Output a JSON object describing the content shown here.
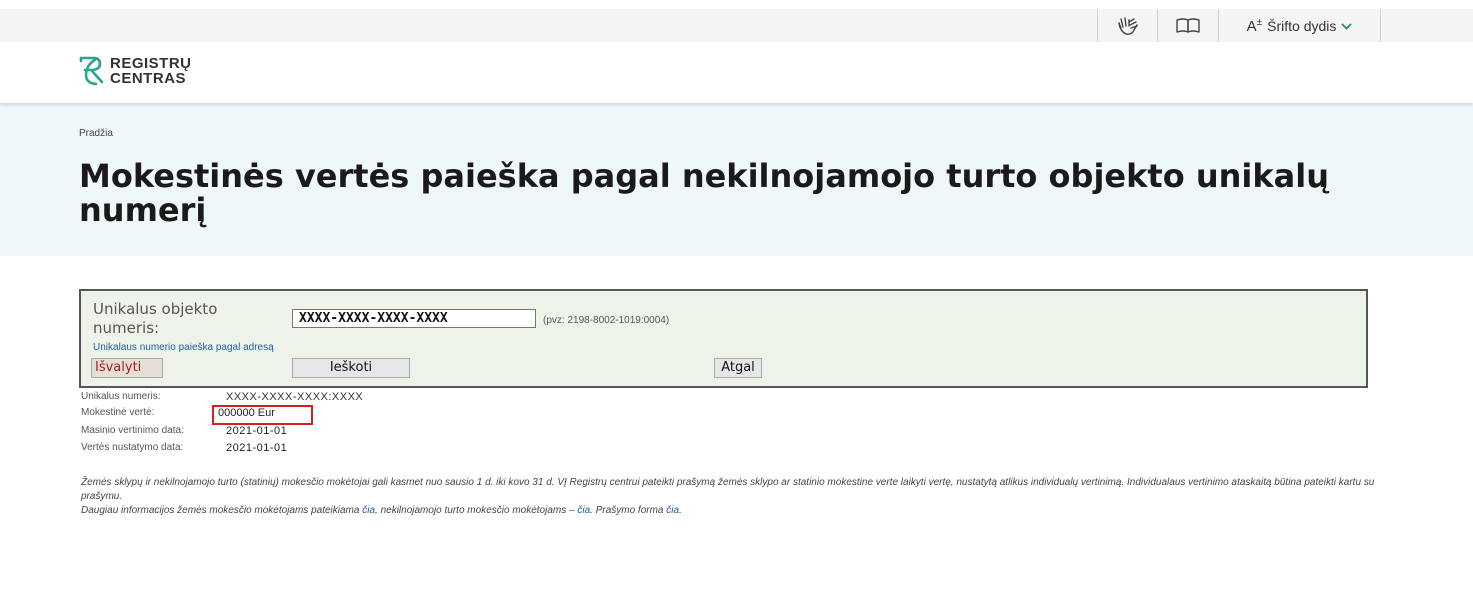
{
  "topbar": {
    "accessibility_icon": "sign-language-icon",
    "book_icon": "book-icon",
    "font_size_label": "Šrifto dydis",
    "font_size_glyph": "A",
    "font_size_glyph_sup": "±"
  },
  "header": {
    "logo_line1": "REGISTRŲ",
    "logo_line2": "CENTRAS"
  },
  "hero": {
    "breadcrumb": "Pradžia",
    "title": "Mokestinės vertės paieška pagal nekilnojamojo turto objekto unikalų numerį"
  },
  "form": {
    "label": "Unikalus objekto numeris:",
    "input_value": "XXXX-XXXX-XXXX-XXXX",
    "example": "(pvz: 2198-8002-1019:0004)",
    "address_link": "Unikalaus numerio paieška pagal adresą",
    "clear_button": "Išvalyti",
    "search_button": "Ieškoti",
    "back_button": "Atgal"
  },
  "results": {
    "unique_number_label": "Unikalus numeris:",
    "unique_number_value": "XXXX-XXXX-XXXX:XXXX",
    "tax_value_label": "Mokestinė vertė:",
    "tax_value_value": "000000 Eur",
    "mass_valuation_label": "Masinio vertinimo data:",
    "mass_valuation_value": "2021-01-01",
    "value_set_label": "Vertės nustatymo data:",
    "value_set_value": "2021-01-01"
  },
  "note": {
    "paragraph1": "Žemės sklypų ir nekilnojamojo turto (statinių) mokesčio mokėtojai gali kasmet nuo sausio 1 d. iki kovo 31 d. VĮ Registrų centrui pateikti prašymą žemės sklypo ar statinio mokestine verte laikyti vertę, nustatytą atlikus individualų vertinimą. Individualaus vertinimo ataskaitą būtina pateikti kartu su prašymu.",
    "p2_part1": "Daugiau informacijos žemės mokesčio mokėtojams pateikiama ",
    "link1": "čia",
    "p2_part2": ", nekilnojamojo turto mokesčio mokėtojams – ",
    "link2": "čia",
    "p2_part3": ". Prašymo forma ",
    "link3": "čia",
    "p2_part4": "."
  },
  "colors": {
    "accent_teal": "#2a8a7a",
    "hero_bg": "#eef7fa",
    "form_bg": "#eef3ea",
    "highlight_red": "#d42020",
    "link_blue": "#1f5f9a"
  }
}
